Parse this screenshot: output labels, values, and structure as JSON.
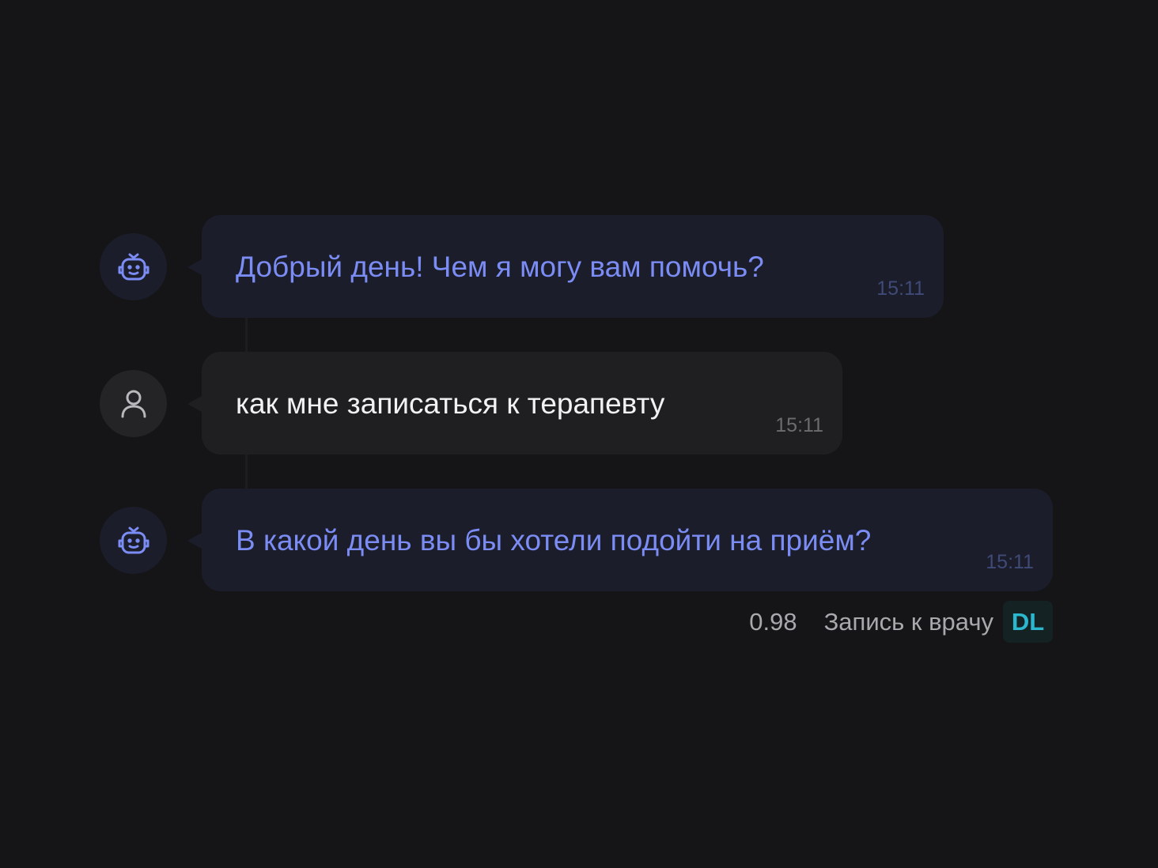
{
  "messages": [
    {
      "sender": "bot",
      "avatar_icon": "bot-icon",
      "text": "Добрый день! Чем я могу вам помочь?",
      "time": "15:11"
    },
    {
      "sender": "user",
      "avatar_icon": "user-icon",
      "text": "как мне записаться к терапевту",
      "time": "15:11"
    },
    {
      "sender": "bot",
      "avatar_icon": "bot-icon",
      "text": "В какой день вы бы хотели подойти на приём?",
      "time": "15:11"
    }
  ],
  "classification": {
    "confidence": "0.98",
    "intent": "Запись к врачу",
    "badge": "DL"
  },
  "colors": {
    "background": "#151517",
    "bot_bubble": "#1b1d2a",
    "user_bubble": "#1f1f21",
    "bot_text": "#7b8cf4",
    "user_text": "#f2f2f4",
    "badge_text": "#2bb8ce"
  }
}
